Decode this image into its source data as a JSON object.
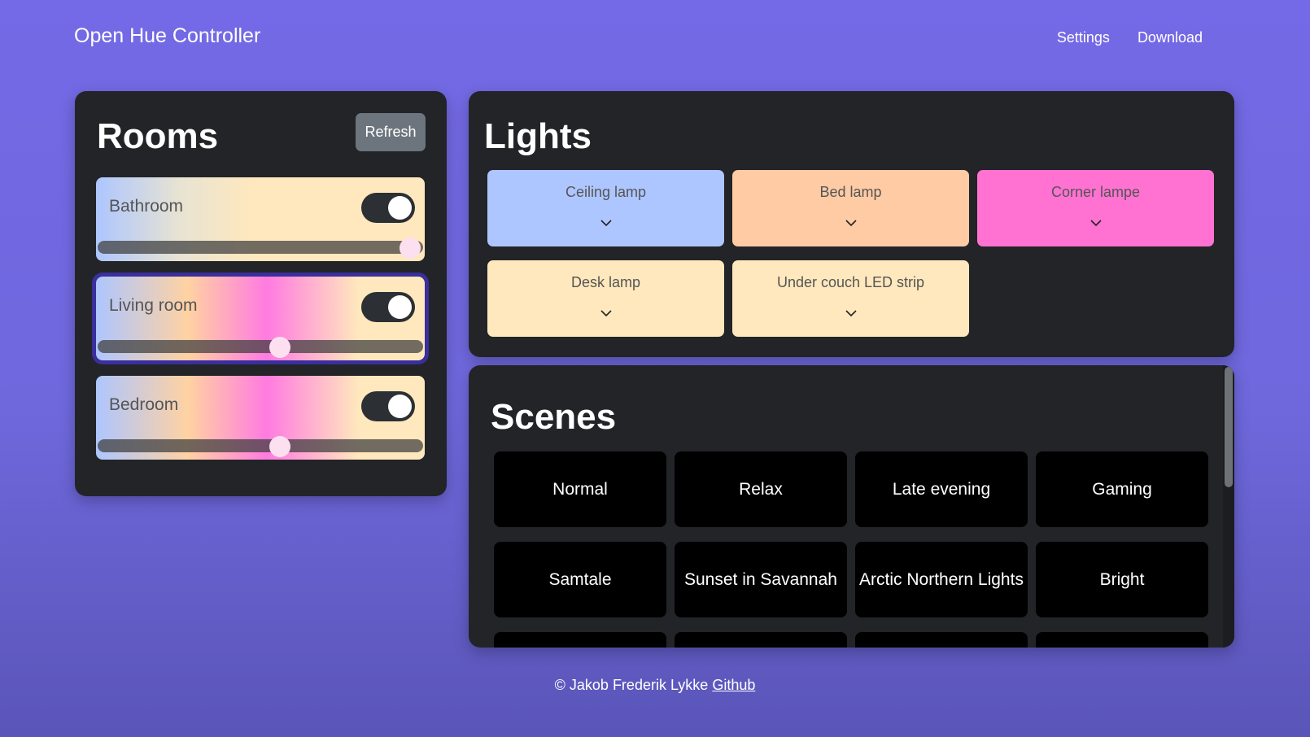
{
  "header": {
    "brand": "Open Hue Controller",
    "nav": [
      {
        "label": "Settings"
      },
      {
        "label": "Download"
      }
    ]
  },
  "rooms": {
    "title": "Rooms",
    "refresh_label": "Refresh",
    "items": [
      {
        "name": "Bathroom",
        "on": true,
        "brightness_pct": 96
      },
      {
        "name": "Living room",
        "on": true,
        "brightness_pct": 56,
        "selected": true
      },
      {
        "name": "Bedroom",
        "on": true,
        "brightness_pct": 56
      }
    ]
  },
  "lights": {
    "title": "Lights",
    "items": [
      {
        "name": "Ceiling lamp",
        "color": "#aec6ff"
      },
      {
        "name": "Bed lamp",
        "color": "#ffcba4"
      },
      {
        "name": "Corner lampe",
        "color": "#ff72d2"
      },
      {
        "name": "Desk lamp",
        "color": "#ffe8bd"
      },
      {
        "name": "Under couch LED strip",
        "color": "#ffe8bd"
      }
    ]
  },
  "scenes": {
    "title": "Scenes",
    "items": [
      "Normal",
      "Relax",
      "Late evening",
      "Gaming",
      "Samtale",
      "Sunset in Savannah",
      "Arctic Northern Lights",
      "Bright"
    ]
  },
  "footer": {
    "copyright": "© Jakob Frederik Lykke ",
    "link": "Github"
  },
  "colors": {
    "background": "#7469e6",
    "panel": "#222428",
    "refresh_button": "#6c757d",
    "selected_outline": "#3a2f9c"
  }
}
